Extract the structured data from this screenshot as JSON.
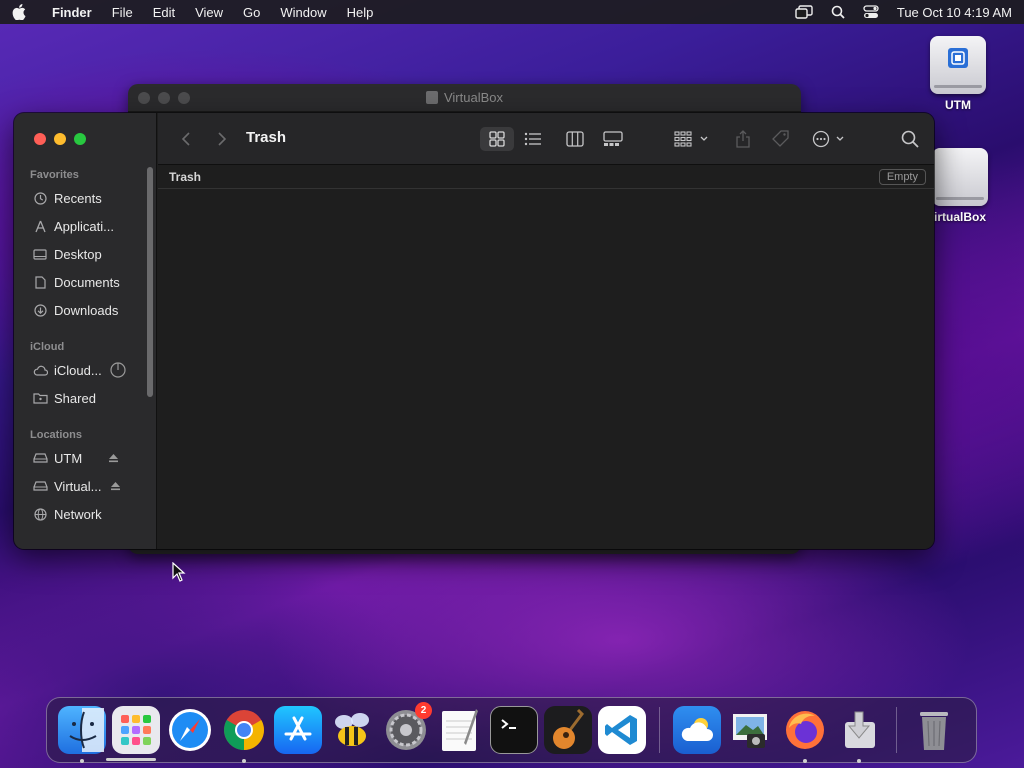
{
  "menubar": {
    "app_name": "Finder",
    "menus": [
      "File",
      "Edit",
      "View",
      "Go",
      "Window",
      "Help"
    ],
    "clock": "Tue Oct 10  4:19 AM",
    "status_icons": [
      "screen-mirroring-icon",
      "search-icon",
      "control-center-icon"
    ]
  },
  "desktop": {
    "icons": [
      {
        "label": "UTM",
        "icon": "external-drive-icon"
      },
      {
        "label": "irtualBox",
        "icon": "external-drive-icon"
      }
    ]
  },
  "background_window": {
    "title": "VirtualBox"
  },
  "finder": {
    "title": "Trash",
    "path": "Trash",
    "empty_button": "Empty",
    "sidebar": {
      "favorites_header": "Favorites",
      "favorites": [
        {
          "label": "Recents",
          "icon": "clock-icon"
        },
        {
          "label": "Applicati...",
          "icon": "applications-icon"
        },
        {
          "label": "Desktop",
          "icon": "desktop-icon"
        },
        {
          "label": "Documents",
          "icon": "document-icon"
        },
        {
          "label": "Downloads",
          "icon": "download-icon"
        }
      ],
      "icloud_header": "iCloud",
      "icloud": [
        {
          "label": "iCloud...",
          "icon": "cloud-icon"
        },
        {
          "label": "Shared",
          "icon": "shared-folder-icon"
        }
      ],
      "locations_header": "Locations",
      "locations": [
        {
          "label": "UTM",
          "icon": "drive-icon"
        },
        {
          "label": "Virtual...",
          "icon": "drive-icon"
        },
        {
          "label": "Network",
          "icon": "globe-icon"
        }
      ]
    }
  },
  "dock": {
    "apps": [
      {
        "name": "Finder",
        "icon": "finder-icon"
      },
      {
        "name": "Launchpad",
        "icon": "launchpad-icon"
      },
      {
        "name": "Safari",
        "icon": "safari-icon"
      },
      {
        "name": "Chrome",
        "icon": "chrome-icon"
      },
      {
        "name": "App Store",
        "icon": "app-store-icon"
      },
      {
        "name": "Cyberduck",
        "icon": "bee-icon"
      },
      {
        "name": "System Settings",
        "icon": "settings-gear-icon",
        "badge": "2"
      },
      {
        "name": "TextEdit",
        "icon": "textedit-icon"
      },
      {
        "name": "Terminal",
        "icon": "terminal-icon"
      },
      {
        "name": "GarageBand",
        "icon": "guitar-icon"
      },
      {
        "name": "VS Code",
        "icon": "vscode-icon"
      },
      {
        "name": "Weather",
        "icon": "weather-icon"
      },
      {
        "name": "Preview",
        "icon": "preview-icon"
      },
      {
        "name": "Firefox",
        "icon": "firefox-icon"
      },
      {
        "name": "Installer",
        "icon": "installer-icon"
      },
      {
        "name": "Trash",
        "icon": "trash-icon"
      }
    ]
  }
}
